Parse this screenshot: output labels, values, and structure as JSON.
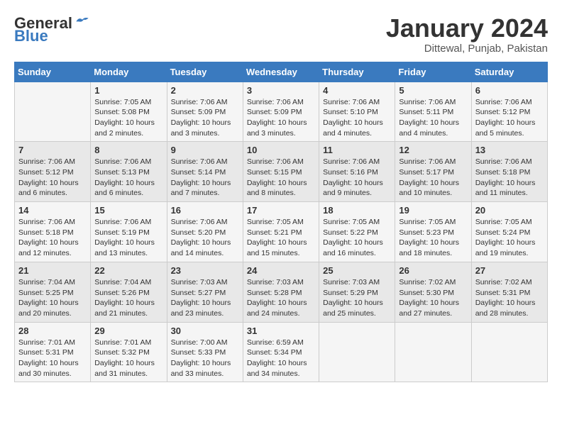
{
  "header": {
    "logo_general": "General",
    "logo_blue": "Blue",
    "month_title": "January 2024",
    "location": "Dittewal, Punjab, Pakistan"
  },
  "calendar": {
    "days_of_week": [
      "Sunday",
      "Monday",
      "Tuesday",
      "Wednesday",
      "Thursday",
      "Friday",
      "Saturday"
    ],
    "weeks": [
      [
        {
          "day": "",
          "info": ""
        },
        {
          "day": "1",
          "info": "Sunrise: 7:05 AM\nSunset: 5:08 PM\nDaylight: 10 hours\nand 2 minutes."
        },
        {
          "day": "2",
          "info": "Sunrise: 7:06 AM\nSunset: 5:09 PM\nDaylight: 10 hours\nand 3 minutes."
        },
        {
          "day": "3",
          "info": "Sunrise: 7:06 AM\nSunset: 5:09 PM\nDaylight: 10 hours\nand 3 minutes."
        },
        {
          "day": "4",
          "info": "Sunrise: 7:06 AM\nSunset: 5:10 PM\nDaylight: 10 hours\nand 4 minutes."
        },
        {
          "day": "5",
          "info": "Sunrise: 7:06 AM\nSunset: 5:11 PM\nDaylight: 10 hours\nand 4 minutes."
        },
        {
          "day": "6",
          "info": "Sunrise: 7:06 AM\nSunset: 5:12 PM\nDaylight: 10 hours\nand 5 minutes."
        }
      ],
      [
        {
          "day": "7",
          "info": "Sunrise: 7:06 AM\nSunset: 5:12 PM\nDaylight: 10 hours\nand 6 minutes."
        },
        {
          "day": "8",
          "info": "Sunrise: 7:06 AM\nSunset: 5:13 PM\nDaylight: 10 hours\nand 6 minutes."
        },
        {
          "day": "9",
          "info": "Sunrise: 7:06 AM\nSunset: 5:14 PM\nDaylight: 10 hours\nand 7 minutes."
        },
        {
          "day": "10",
          "info": "Sunrise: 7:06 AM\nSunset: 5:15 PM\nDaylight: 10 hours\nand 8 minutes."
        },
        {
          "day": "11",
          "info": "Sunrise: 7:06 AM\nSunset: 5:16 PM\nDaylight: 10 hours\nand 9 minutes."
        },
        {
          "day": "12",
          "info": "Sunrise: 7:06 AM\nSunset: 5:17 PM\nDaylight: 10 hours\nand 10 minutes."
        },
        {
          "day": "13",
          "info": "Sunrise: 7:06 AM\nSunset: 5:18 PM\nDaylight: 10 hours\nand 11 minutes."
        }
      ],
      [
        {
          "day": "14",
          "info": "Sunrise: 7:06 AM\nSunset: 5:18 PM\nDaylight: 10 hours\nand 12 minutes."
        },
        {
          "day": "15",
          "info": "Sunrise: 7:06 AM\nSunset: 5:19 PM\nDaylight: 10 hours\nand 13 minutes."
        },
        {
          "day": "16",
          "info": "Sunrise: 7:06 AM\nSunset: 5:20 PM\nDaylight: 10 hours\nand 14 minutes."
        },
        {
          "day": "17",
          "info": "Sunrise: 7:05 AM\nSunset: 5:21 PM\nDaylight: 10 hours\nand 15 minutes."
        },
        {
          "day": "18",
          "info": "Sunrise: 7:05 AM\nSunset: 5:22 PM\nDaylight: 10 hours\nand 16 minutes."
        },
        {
          "day": "19",
          "info": "Sunrise: 7:05 AM\nSunset: 5:23 PM\nDaylight: 10 hours\nand 18 minutes."
        },
        {
          "day": "20",
          "info": "Sunrise: 7:05 AM\nSunset: 5:24 PM\nDaylight: 10 hours\nand 19 minutes."
        }
      ],
      [
        {
          "day": "21",
          "info": "Sunrise: 7:04 AM\nSunset: 5:25 PM\nDaylight: 10 hours\nand 20 minutes."
        },
        {
          "day": "22",
          "info": "Sunrise: 7:04 AM\nSunset: 5:26 PM\nDaylight: 10 hours\nand 21 minutes."
        },
        {
          "day": "23",
          "info": "Sunrise: 7:03 AM\nSunset: 5:27 PM\nDaylight: 10 hours\nand 23 minutes."
        },
        {
          "day": "24",
          "info": "Sunrise: 7:03 AM\nSunset: 5:28 PM\nDaylight: 10 hours\nand 24 minutes."
        },
        {
          "day": "25",
          "info": "Sunrise: 7:03 AM\nSunset: 5:29 PM\nDaylight: 10 hours\nand 25 minutes."
        },
        {
          "day": "26",
          "info": "Sunrise: 7:02 AM\nSunset: 5:30 PM\nDaylight: 10 hours\nand 27 minutes."
        },
        {
          "day": "27",
          "info": "Sunrise: 7:02 AM\nSunset: 5:31 PM\nDaylight: 10 hours\nand 28 minutes."
        }
      ],
      [
        {
          "day": "28",
          "info": "Sunrise: 7:01 AM\nSunset: 5:31 PM\nDaylight: 10 hours\nand 30 minutes."
        },
        {
          "day": "29",
          "info": "Sunrise: 7:01 AM\nSunset: 5:32 PM\nDaylight: 10 hours\nand 31 minutes."
        },
        {
          "day": "30",
          "info": "Sunrise: 7:00 AM\nSunset: 5:33 PM\nDaylight: 10 hours\nand 33 minutes."
        },
        {
          "day": "31",
          "info": "Sunrise: 6:59 AM\nSunset: 5:34 PM\nDaylight: 10 hours\nand 34 minutes."
        },
        {
          "day": "",
          "info": ""
        },
        {
          "day": "",
          "info": ""
        },
        {
          "day": "",
          "info": ""
        }
      ]
    ]
  }
}
